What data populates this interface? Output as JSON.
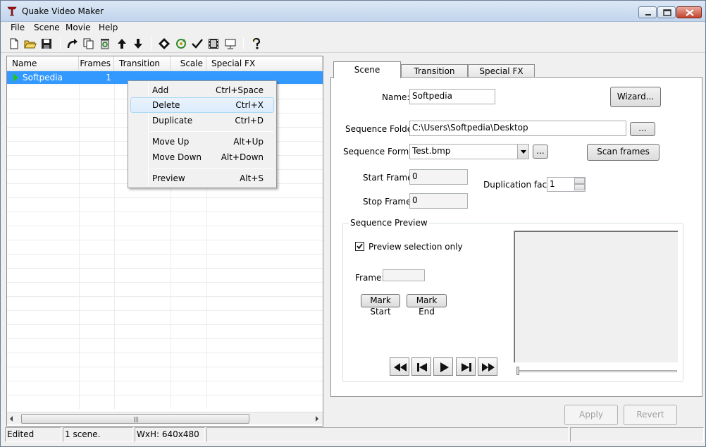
{
  "window": {
    "title": "Quake Video Maker"
  },
  "menu": [
    "File",
    "Scene",
    "Movie",
    "Help"
  ],
  "toolbar_icons": [
    "new-icon",
    "open-icon",
    "save-icon",
    "redo-icon",
    "copy-icon",
    "recycle-icon",
    "move-up-icon",
    "move-down-icon",
    "diamond-icon",
    "refresh-icon",
    "check-icon",
    "film-icon",
    "monitor-icon",
    "help-icon"
  ],
  "list": {
    "columns": [
      "Name",
      "Frames",
      "Transition",
      "Scale",
      "Special FX"
    ],
    "rows": [
      {
        "name": "Softpedia",
        "frames": "1",
        "transition": "",
        "scale": "",
        "special_fx": ""
      }
    ]
  },
  "context_menu": {
    "items": [
      {
        "label": "Add",
        "shortcut": "Ctrl+Space"
      },
      {
        "label": "Delete",
        "shortcut": "Ctrl+X"
      },
      {
        "label": "Duplicate",
        "shortcut": "Ctrl+D"
      },
      {
        "label": "Move Up",
        "shortcut": "Alt+Up"
      },
      {
        "label": "Move Down",
        "shortcut": "Alt+Down"
      },
      {
        "label": "Preview",
        "shortcut": "Alt+S"
      }
    ],
    "hovered": "Delete"
  },
  "tabs": [
    "Scene",
    "Transition",
    "Special FX"
  ],
  "active_tab": "Scene",
  "scene": {
    "name_label": "Name:",
    "name_value": "Softpedia",
    "wizard_button": "Wizard...",
    "folder_label": "Sequence Folder:",
    "folder_value": "C:\\Users\\Softpedia\\Desktop",
    "browse_button": "...",
    "format_label": "Sequence Format:",
    "format_value": "Test.bmp",
    "format_browse_button": "...",
    "scan_button": "Scan frames",
    "start_label": "Start Frame:",
    "start_value": "0",
    "stop_label": "Stop Frame:",
    "stop_value": "0",
    "dup_label": "Duplication factor:",
    "dup_value": "1"
  },
  "preview": {
    "group_title": "Sequence Preview",
    "selection_only_label": "Preview selection only",
    "selection_only_checked": true,
    "frame_label": "Frame:",
    "frame_value": "",
    "mark_start": "Mark Start",
    "mark_end": "Mark End",
    "media_icons": [
      "rewind-icon",
      "skip-back-icon",
      "play-icon",
      "skip-forward-icon",
      "fast-forward-icon"
    ]
  },
  "footer_buttons": {
    "apply": "Apply",
    "revert": "Revert"
  },
  "status": {
    "state": "Edited",
    "scenes": "1 scene.",
    "size": "WxH: 640x480"
  },
  "colors": {
    "selection": "#3399ff",
    "arrow_green": "#22c322"
  }
}
